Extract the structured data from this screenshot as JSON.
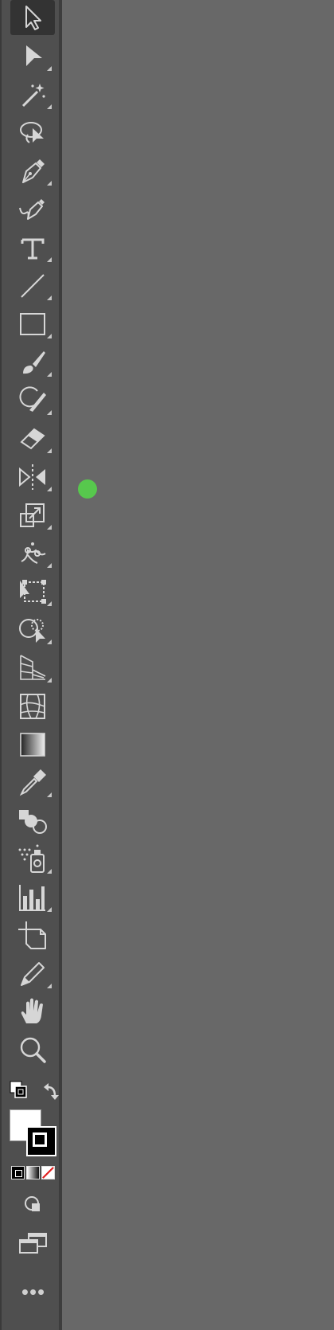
{
  "colors": {
    "panel": "#4f4f4f",
    "canvas": "#686868",
    "icon": "#d6d6d6",
    "active_tool_bg": "#333333",
    "marker": "#57c84d",
    "fill": "#ffffff",
    "stroke": "#000000",
    "none_slash": "#e02020"
  },
  "tools": [
    {
      "name": "selection-tool-icon",
      "active": true
    },
    {
      "name": "direct-selection-tool-icon"
    },
    {
      "name": "magic-wand-tool-icon"
    },
    {
      "name": "lasso-tool-icon"
    },
    {
      "name": "pen-tool-icon"
    },
    {
      "name": "curvature-tool-icon"
    },
    {
      "name": "type-tool-icon"
    },
    {
      "name": "line-segment-tool-icon"
    },
    {
      "name": "rectangle-tool-icon"
    },
    {
      "name": "paintbrush-tool-icon"
    },
    {
      "name": "blob-brush-tool-icon"
    },
    {
      "name": "eraser-tool-icon"
    },
    {
      "name": "reflect-tool-icon"
    },
    {
      "name": "scale-tool-icon"
    },
    {
      "name": "puppet-warp-tool-icon"
    },
    {
      "name": "free-transform-tool-icon"
    },
    {
      "name": "shape-builder-tool-icon"
    },
    {
      "name": "perspective-grid-tool-icon"
    },
    {
      "name": "mesh-tool-icon"
    },
    {
      "name": "gradient-tool-icon"
    },
    {
      "name": "eyedropper-tool-icon"
    },
    {
      "name": "blend-tool-icon"
    },
    {
      "name": "symbol-sprayer-tool-icon"
    },
    {
      "name": "column-graph-tool-icon"
    },
    {
      "name": "artboard-tool-icon"
    },
    {
      "name": "slice-tool-icon"
    },
    {
      "name": "hand-tool-icon"
    },
    {
      "name": "zoom-tool-icon"
    }
  ],
  "more_tools_label": "•••"
}
